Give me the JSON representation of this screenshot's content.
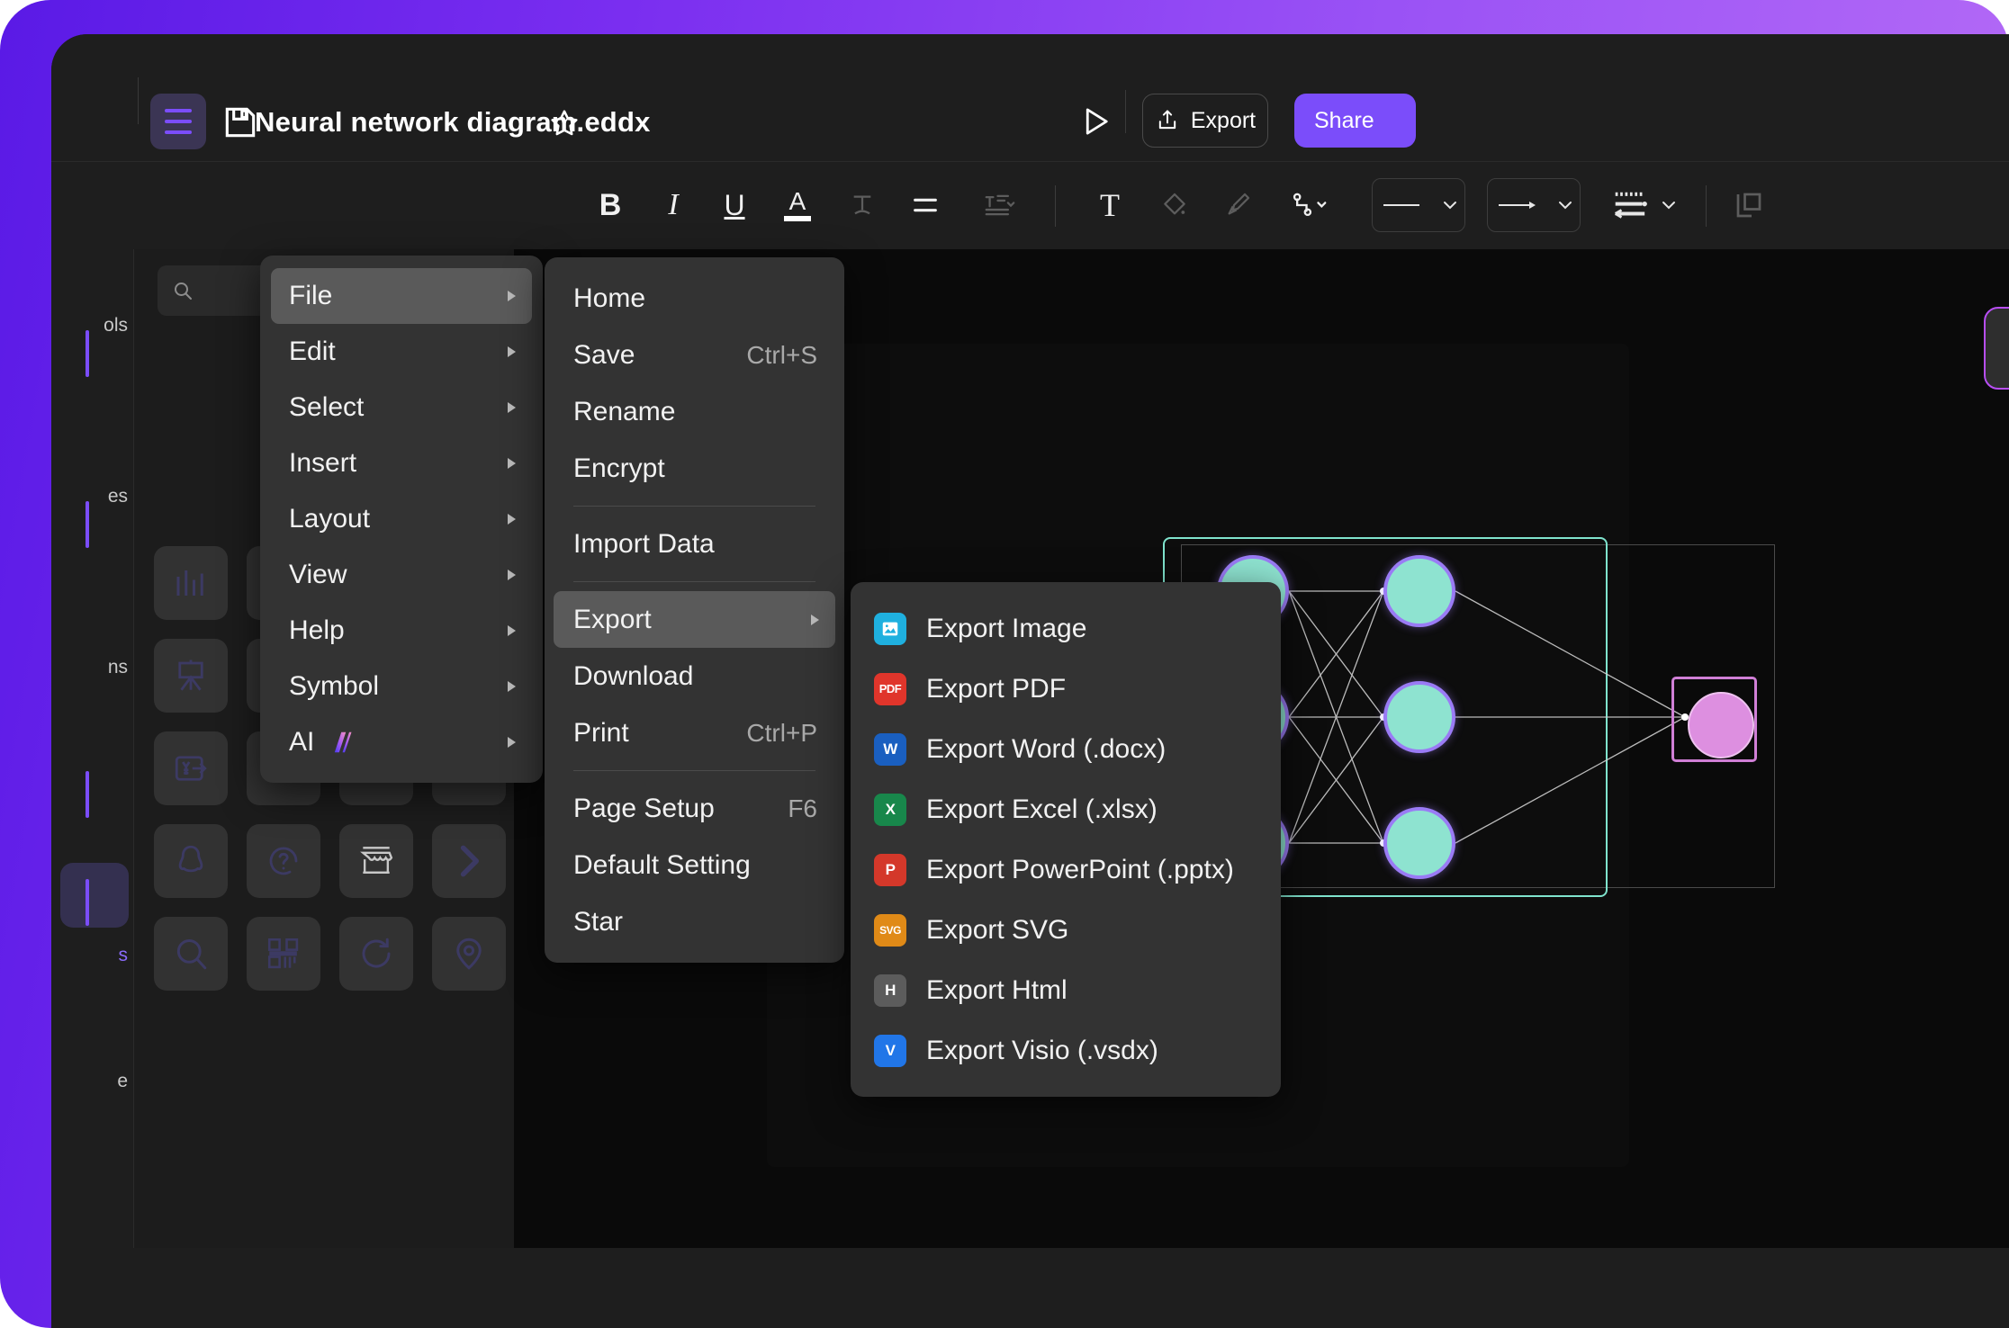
{
  "app": {
    "title": "Neural network diagram.eddx",
    "save_icon": "floppy-disk-icon",
    "star_icon": "star-outline-icon",
    "hamburger_icon": "hamburger-menu-icon"
  },
  "titlebar": {
    "present_label": "present-play-icon",
    "export_label": "Export",
    "export_icon": "share-upload-icon",
    "share_label": "Share"
  },
  "toolbar": {
    "bold": "B",
    "italic": "I",
    "underline": "U",
    "font_color": "A",
    "text_effect": "T",
    "align": "align-left-icon",
    "line_spacing": "line-spacing-icon",
    "text_box": "T",
    "fill": "paint-bucket-icon",
    "brush": "brush-icon",
    "connector": "connector-icon",
    "line_style": "line-style-preview",
    "arrow_style": "arrow-style-preview",
    "line_pattern": "line-pattern-icon",
    "layer": "layer-icon"
  },
  "rail": {
    "items": [
      {
        "label": "ols"
      },
      {
        "label": "es"
      },
      {
        "label": "ns"
      },
      {
        "label": "s",
        "active": true
      },
      {
        "label": "e"
      }
    ]
  },
  "shape_panel": {
    "search_placeholder": "",
    "search_value": "",
    "search_icon": "search-icon",
    "shapes": [
      {
        "name": "bar-chart-icon"
      },
      {
        "name": "blank-icon"
      },
      {
        "name": "clock-icon"
      },
      {
        "name": "blank2-icon"
      },
      {
        "name": "easel-icon"
      },
      {
        "name": "office-building-icon"
      },
      {
        "name": "money-circle-icon"
      },
      {
        "name": "blank3-icon"
      },
      {
        "name": "yen-transfer-icon"
      },
      {
        "name": "home-icon"
      },
      {
        "name": "plus-icon"
      },
      {
        "name": "contact-card-icon"
      },
      {
        "name": "penguin-icon"
      },
      {
        "name": "help-circle-icon"
      },
      {
        "name": "storefront-icon"
      },
      {
        "name": "chevron-right-icon"
      },
      {
        "name": "search-glass-icon"
      },
      {
        "name": "qr-code-icon"
      },
      {
        "name": "refresh-icon"
      },
      {
        "name": "location-pin-icon"
      }
    ]
  },
  "canvas": {
    "ai_tab": "ai-assistant-tab",
    "diagram": {
      "name": "neural-network-diagram",
      "hidden_layer_nodes": 6,
      "output_nodes": 1,
      "node_fill": "#8ee3d0",
      "node_stroke": "#9a7bf5",
      "output_fill": "#dd8fe0",
      "output_stroke": "#d07fd6",
      "group_stroke": "#7fe3cd"
    }
  },
  "menu_main": {
    "items": [
      {
        "label": "File",
        "selected": true,
        "submenu": true
      },
      {
        "label": "Edit",
        "submenu": true
      },
      {
        "label": "Select",
        "submenu": true
      },
      {
        "label": "Insert",
        "submenu": true
      },
      {
        "label": "Layout",
        "submenu": true
      },
      {
        "label": "View",
        "submenu": true
      },
      {
        "label": "Help",
        "submenu": true
      },
      {
        "label": "Symbol",
        "submenu": true
      },
      {
        "label": "AI",
        "submenu": true,
        "badge": "ai-sparkle-icon"
      }
    ]
  },
  "menu_file": {
    "items": [
      {
        "label": "Home",
        "shortcut": ""
      },
      {
        "label": "Save",
        "shortcut": "Ctrl+S"
      },
      {
        "label": "Rename",
        "shortcut": ""
      },
      {
        "label": "Encrypt",
        "shortcut": ""
      },
      {
        "separator_after": true
      },
      {
        "label": "Import Data",
        "shortcut": ""
      },
      {
        "separator_after": true
      },
      {
        "label": "Export",
        "shortcut": "",
        "selected": true,
        "submenu": true
      },
      {
        "label": "Download",
        "shortcut": ""
      },
      {
        "label": "Print",
        "shortcut": "Ctrl+P"
      },
      {
        "separator_after": true
      },
      {
        "label": "Page Setup",
        "shortcut": "F6"
      },
      {
        "label": "Default Setting",
        "shortcut": ""
      },
      {
        "label": "Star",
        "shortcut": ""
      }
    ]
  },
  "menu_export": {
    "items": [
      {
        "label": "Export Image",
        "icon": "image-icon",
        "icon_text": "",
        "color": "#1fb0df"
      },
      {
        "label": "Export PDF",
        "icon": "pdf-icon",
        "icon_text": "PDF",
        "color": "#e0352b"
      },
      {
        "label": "Export Word (.docx)",
        "icon": "word-icon",
        "icon_text": "W",
        "color": "#1a5fc0"
      },
      {
        "label": "Export Excel (.xlsx)",
        "icon": "excel-icon",
        "icon_text": "X",
        "color": "#18874b"
      },
      {
        "label": "Export PowerPoint (.pptx)",
        "icon": "powerpoint-icon",
        "icon_text": "P",
        "color": "#d4382a"
      },
      {
        "label": "Export SVG",
        "icon": "svg-icon",
        "icon_text": "SVG",
        "color": "#e08a17"
      },
      {
        "label": "Export Html",
        "icon": "html-icon",
        "icon_text": "H",
        "color": "#5c5c5c"
      },
      {
        "label": "Export Visio (.vsdx)",
        "icon": "visio-icon",
        "icon_text": "V",
        "color": "#2176e8"
      }
    ]
  }
}
